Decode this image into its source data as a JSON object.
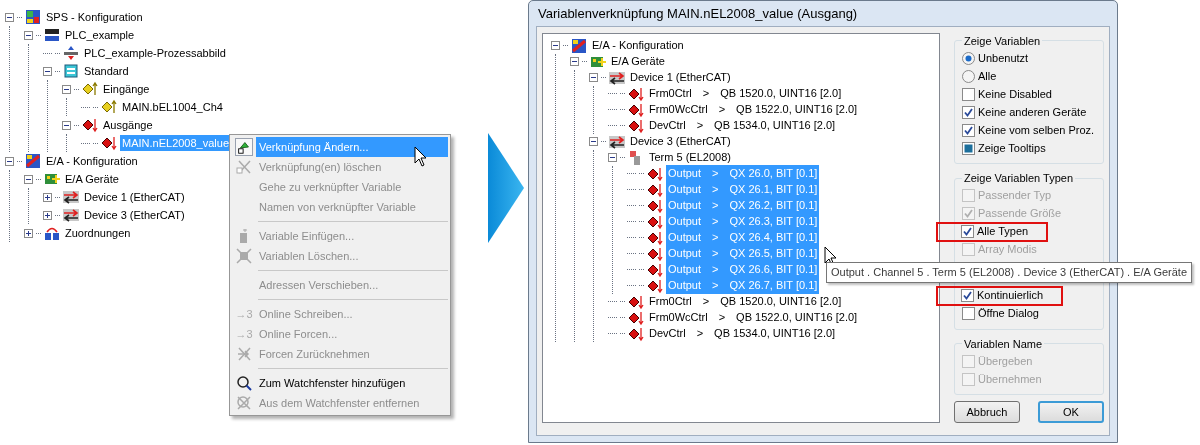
{
  "left_tree": [
    {
      "label": "SPS - Konfiguration",
      "kind": "plc",
      "expanded": true,
      "selected": false,
      "children": [
        {
          "label": "PLC_example",
          "kind": "iec",
          "expanded": true,
          "selected": false,
          "children": [
            {
              "label": "PLC_example-Prozessabbild",
              "kind": "image",
              "selected": false
            },
            {
              "label": "Standard",
              "kind": "task",
              "expanded": true,
              "selected": false,
              "children": [
                {
                  "label": "Eingänge",
                  "kind": "inputs",
                  "expanded": true,
                  "selected": false,
                  "children": [
                    {
                      "label": "MAIN.bEL1004_Ch4",
                      "kind": "input-var",
                      "selected": false
                    }
                  ]
                },
                {
                  "label": "Ausgänge",
                  "kind": "outputs",
                  "expanded": true,
                  "selected": false,
                  "children": [
                    {
                      "label": "MAIN.nEL2008_value",
                      "kind": "output-var",
                      "selected": true
                    }
                  ]
                }
              ]
            }
          ]
        }
      ]
    },
    {
      "label": "E/A - Konfiguration",
      "kind": "io",
      "expanded": true,
      "selected": false,
      "children": [
        {
          "label": "E/A Geräte",
          "kind": "devices",
          "expanded": true,
          "selected": false,
          "children": [
            {
              "label": "Device 1 (EtherCAT)",
              "kind": "device",
              "expanded": false,
              "selected": false
            },
            {
              "label": "Device 3 (EtherCAT)",
              "kind": "device",
              "expanded": false,
              "selected": false
            }
          ]
        },
        {
          "label": "Zuordnungen",
          "kind": "mappings",
          "expanded": false,
          "selected": false
        }
      ]
    }
  ],
  "context_menu": {
    "items": [
      {
        "kind": "item",
        "label": "Verknüpfung Ändern...",
        "disabled": false,
        "selected": true
      },
      {
        "kind": "item",
        "label": "Verknüpfung(en) löschen",
        "disabled": true,
        "selected": false
      },
      {
        "kind": "item",
        "label": "Gehe zu verknüpfter Variable",
        "disabled": true,
        "selected": false
      },
      {
        "kind": "item",
        "label": "Namen von verknüpfter Variable",
        "disabled": true,
        "selected": false
      },
      {
        "kind": "separator"
      },
      {
        "kind": "item",
        "label": "Variable Einfügen...",
        "disabled": true,
        "selected": false
      },
      {
        "kind": "item",
        "label": "Variablen Löschen...",
        "disabled": true,
        "selected": false
      },
      {
        "kind": "separator"
      },
      {
        "kind": "item",
        "label": "Adressen Verschieben...",
        "disabled": true,
        "selected": false
      },
      {
        "kind": "separator"
      },
      {
        "kind": "item",
        "icon_text": "→3",
        "label": "Online Schreiben...",
        "disabled": true,
        "selected": false
      },
      {
        "kind": "item",
        "icon_text": "→3",
        "label": "Online Forcen...",
        "disabled": true,
        "selected": false
      },
      {
        "kind": "item",
        "label": "Forcen Zurücknehmen",
        "disabled": true,
        "selected": false
      },
      {
        "kind": "separator"
      },
      {
        "kind": "item",
        "label": "Zum Watchfenster hinzufügen",
        "disabled": false,
        "selected": false
      },
      {
        "kind": "item",
        "label": "Aus dem Watchfenster entfernen",
        "disabled": true,
        "selected": false
      }
    ]
  },
  "dialog": {
    "title": "Variablenverknüpfung MAIN.nEL2008_value (Ausgang)",
    "tree": [
      {
        "label": "E/A - Konfiguration",
        "kind": "io",
        "expanded": true,
        "children": [
          {
            "label": "E/A Geräte",
            "kind": "devices",
            "expanded": true,
            "children": [
              {
                "label": "Device 1 (EtherCAT)",
                "kind": "device",
                "expanded": true,
                "children": [
                  {
                    "label": "Frm0Ctrl",
                    "link": ">",
                    "address": "QB 1520.0, UINT16 [2.0]",
                    "kind": "output-var",
                    "selected": false
                  },
                  {
                    "label": "Frm0WcCtrl",
                    "link": ">",
                    "address": "QB 1522.0, UINT16 [2.0]",
                    "kind": "output-var",
                    "selected": false
                  },
                  {
                    "label": "DevCtrl",
                    "link": ">",
                    "address": "QB 1534.0, UINT16 [2.0]",
                    "kind": "output-var",
                    "selected": false
                  }
                ]
              },
              {
                "label": "Device 3 (EtherCAT)",
                "kind": "device",
                "expanded": true,
                "children": [
                  {
                    "label": "Term 5 (EL2008)",
                    "kind": "term",
                    "expanded": true,
                    "children": [
                      {
                        "label": "Output",
                        "link": ">",
                        "address": "QX 26.0, BIT [0.1]",
                        "kind": "output-var",
                        "selected": true
                      },
                      {
                        "label": "Output",
                        "link": ">",
                        "address": "QX 26.1, BIT [0.1]",
                        "kind": "output-var",
                        "selected": true
                      },
                      {
                        "label": "Output",
                        "link": ">",
                        "address": "QX 26.2, BIT [0.1]",
                        "kind": "output-var",
                        "selected": true
                      },
                      {
                        "label": "Output",
                        "link": ">",
                        "address": "QX 26.3, BIT [0.1]",
                        "kind": "output-var",
                        "selected": true
                      },
                      {
                        "label": "Output",
                        "link": ">",
                        "address": "QX 26.4, BIT [0.1]",
                        "kind": "output-var",
                        "selected": true
                      },
                      {
                        "label": "Output",
                        "link": ">",
                        "address": "QX 26.5, BIT [0.1]",
                        "kind": "output-var",
                        "selected": true
                      },
                      {
                        "label": "Output",
                        "link": ">",
                        "address": "QX 26.6, BIT [0.1]",
                        "kind": "output-var",
                        "selected": true
                      },
                      {
                        "label": "Output",
                        "link": ">",
                        "address": "QX 26.7, BIT [0.1]",
                        "kind": "output-var",
                        "selected": true
                      }
                    ]
                  },
                  {
                    "label": "Frm0Ctrl",
                    "link": ">",
                    "address": "QB 1520.0, UINT16 [2.0]",
                    "kind": "output-var",
                    "selected": false
                  },
                  {
                    "label": "Frm0WcCtrl",
                    "link": ">",
                    "address": "QB 1522.0, UINT16 [2.0]",
                    "kind": "output-var",
                    "selected": false
                  },
                  {
                    "label": "DevCtrl",
                    "link": ">",
                    "address": "QB 1534.0, UINT16 [2.0]",
                    "kind": "output-var",
                    "selected": false
                  }
                ]
              }
            ]
          }
        ]
      }
    ],
    "groups": [
      {
        "title": "Zeige Variablen",
        "items": [
          {
            "kind": "radio",
            "label": "Unbenutzt",
            "checked": true,
            "disabled": false,
            "highlighted": false
          },
          {
            "kind": "radio",
            "label": "Alle",
            "checked": false,
            "disabled": false,
            "highlighted": false
          },
          {
            "kind": "checkbox",
            "label": "Keine Disabled",
            "checked": false,
            "disabled": false,
            "highlighted": false
          },
          {
            "kind": "checkbox",
            "label": "Keine anderen Geräte",
            "checked": true,
            "disabled": false,
            "highlighted": false
          },
          {
            "kind": "checkbox",
            "label": "Keine vom selben Proz.",
            "checked": true,
            "disabled": false,
            "highlighted": false
          },
          {
            "kind": "square",
            "label": "Zeige Tooltips",
            "checked": true,
            "disabled": false,
            "highlighted": false
          }
        ]
      },
      {
        "title": "Zeige Variablen Typen",
        "items": [
          {
            "kind": "checkbox",
            "label": "Passender Typ",
            "checked": false,
            "disabled": true,
            "highlighted": false
          },
          {
            "kind": "checkbox",
            "label": "Passende Größe",
            "checked": true,
            "disabled": true,
            "highlighted": false
          },
          {
            "kind": "checkbox",
            "label": "Alle Typen",
            "checked": true,
            "disabled": false,
            "highlighted": true
          },
          {
            "kind": "checkbox",
            "label": "Array Modis",
            "checked": false,
            "disabled": true,
            "highlighted": false
          },
          {
            "kind": "checkbox",
            "label": "Kontinuierlich",
            "checked": true,
            "disabled": false,
            "highlighted": true
          },
          {
            "kind": "checkbox",
            "label": "Öffne Dialog",
            "checked": false,
            "disabled": false,
            "highlighted": false
          }
        ]
      },
      {
        "title": "Variablen Name",
        "items": [
          {
            "kind": "checkbox",
            "label": "Übergeben",
            "checked": false,
            "disabled": true,
            "highlighted": false
          },
          {
            "kind": "checkbox",
            "label": "Übernehmen",
            "checked": false,
            "disabled": true,
            "highlighted": false
          }
        ]
      }
    ],
    "tooltip": "Output . Channel 5 . Term 5 (EL2008) . Device 3 (EtherCAT) . E/A Geräte",
    "buttons": [
      {
        "label": "Abbruch",
        "default": false
      },
      {
        "label": "OK",
        "default": true
      }
    ]
  }
}
